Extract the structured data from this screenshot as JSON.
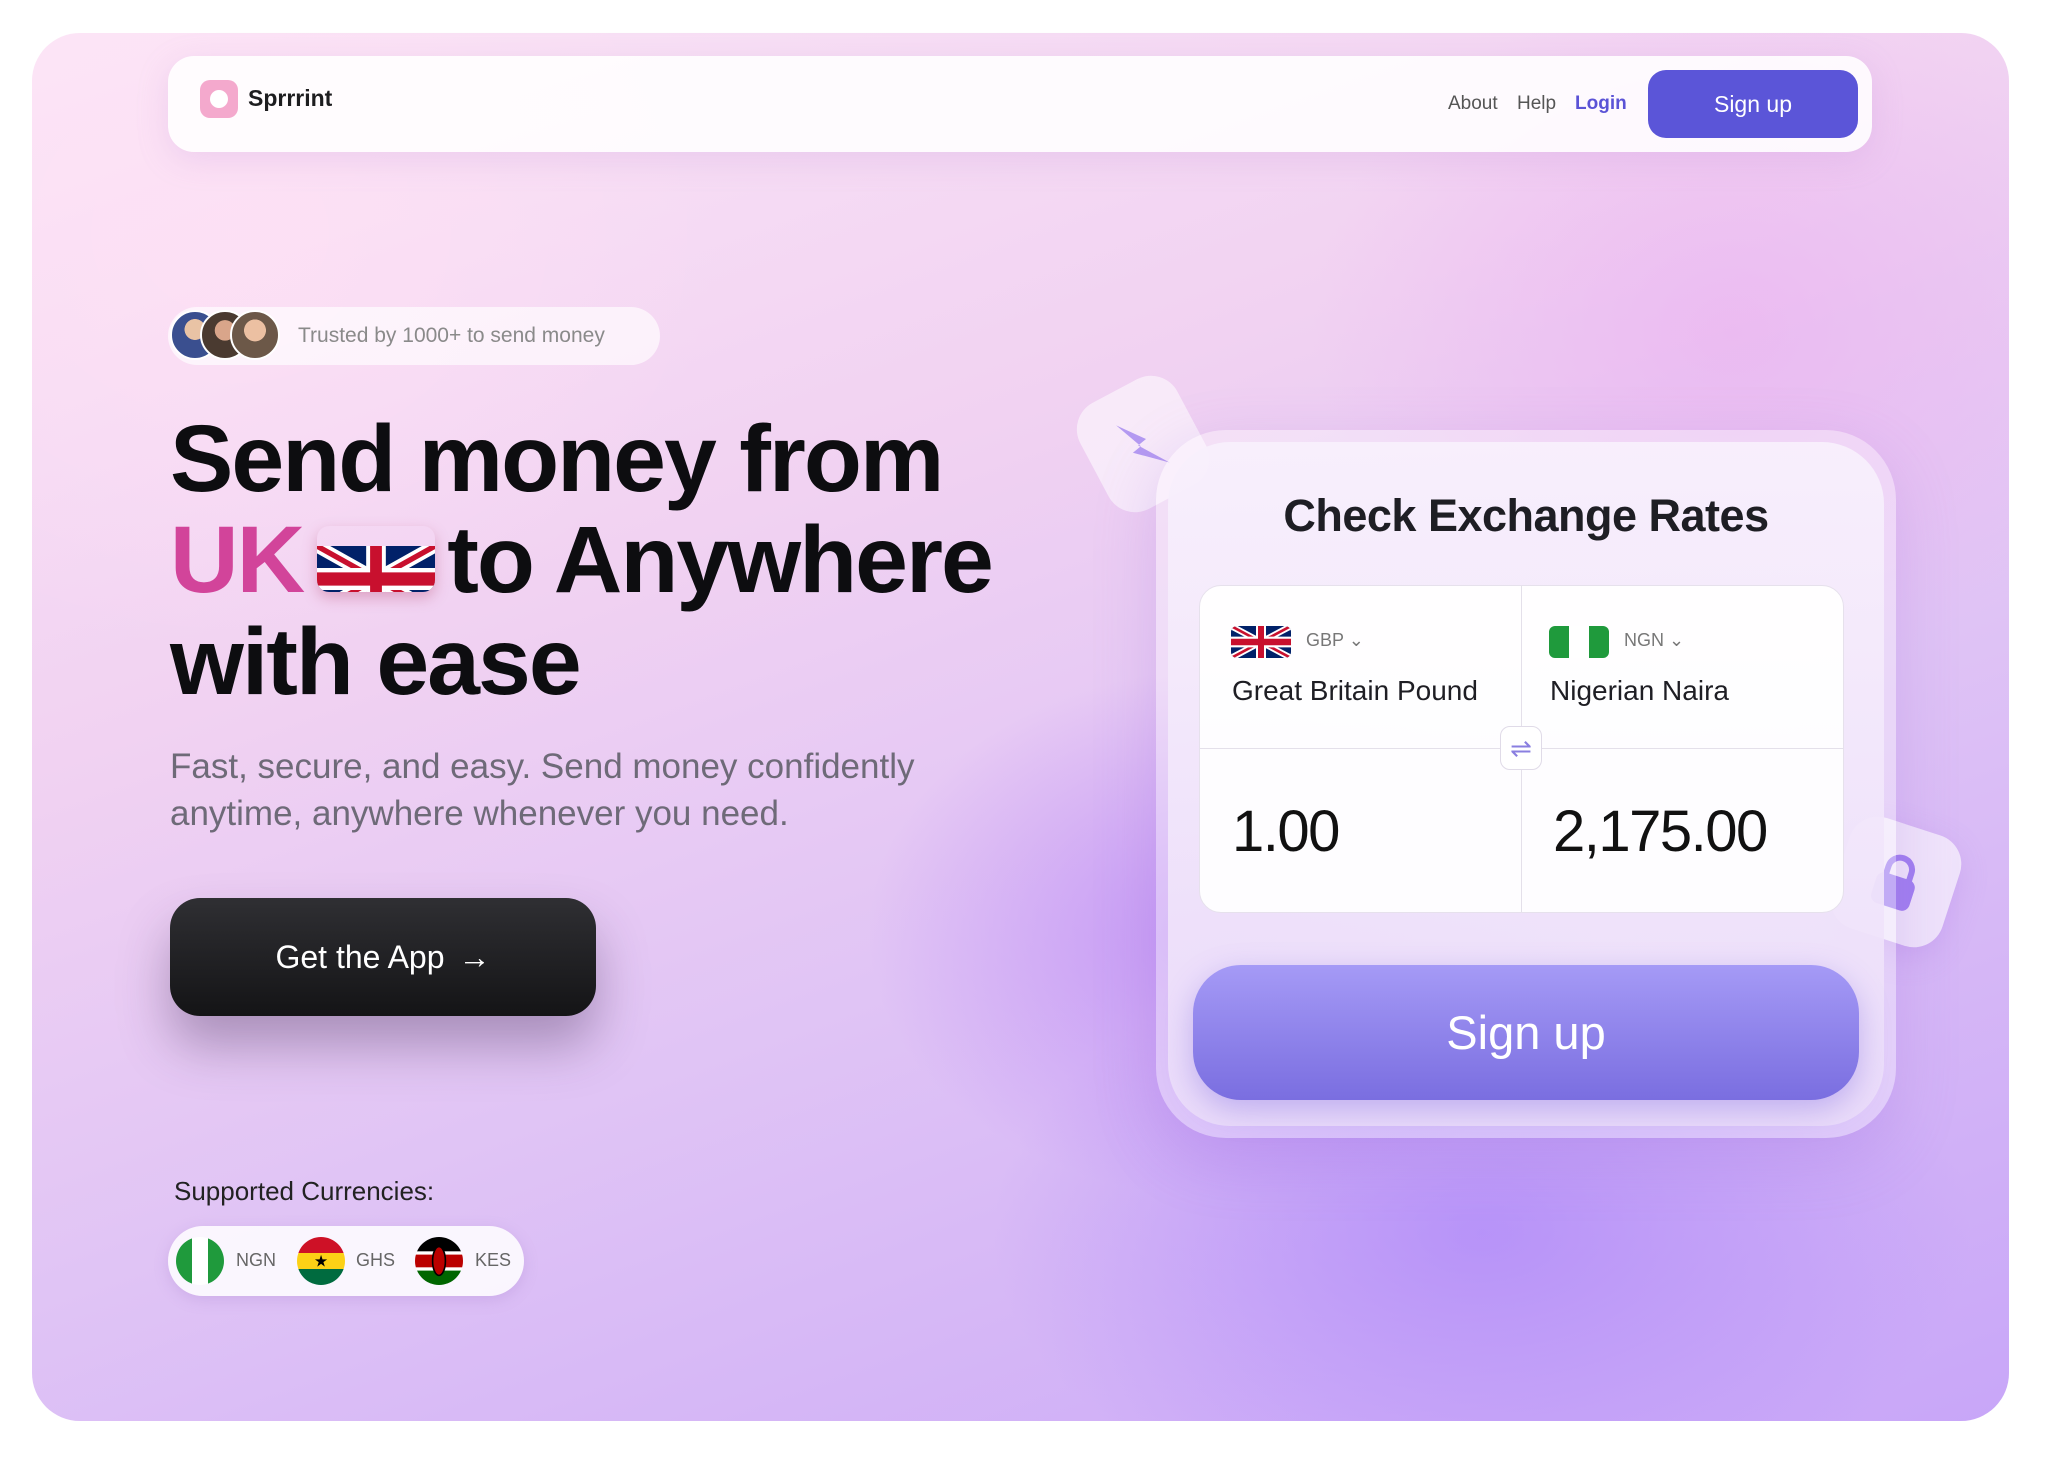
{
  "nav": {
    "brand": "Sprrrint",
    "links": {
      "about": "About",
      "help": "Help",
      "login": "Login"
    },
    "signup": "Sign up"
  },
  "hero": {
    "trust_text": "Trusted by 1000+ to send money",
    "headline_line1": "Send money from",
    "headline_uk": "UK",
    "headline_line2_rest": "to Anywhere",
    "headline_line3": "with ease",
    "subtext_line1": "Fast, secure, and easy. Send money confidently",
    "subtext_line2": "anytime, anywhere whenever you need.",
    "cta": "Get the App",
    "cta_arrow": "→"
  },
  "currencies": {
    "label": "Supported Currencies:",
    "items": [
      {
        "code": "NGN",
        "flag": "nigeria-flag"
      },
      {
        "code": "GHS",
        "flag": "ghana-flag"
      },
      {
        "code": "KES",
        "flag": "kenya-flag"
      }
    ]
  },
  "exchange": {
    "title": "Check Exchange Rates",
    "from": {
      "code": "GBP",
      "name": "Great Britain Pound",
      "amount": "1.00",
      "flag": "uk-flag"
    },
    "to": {
      "code": "NGN",
      "name": "Nigerian Naira",
      "amount": "2,175.00",
      "flag": "nigeria-flag"
    },
    "swap_icon": "swap-arrows-icon",
    "signup": "Sign up"
  },
  "colors": {
    "accent": "#5b55d8",
    "uk_text": "#d2449a",
    "cta_bg": "#1a1a1c"
  }
}
